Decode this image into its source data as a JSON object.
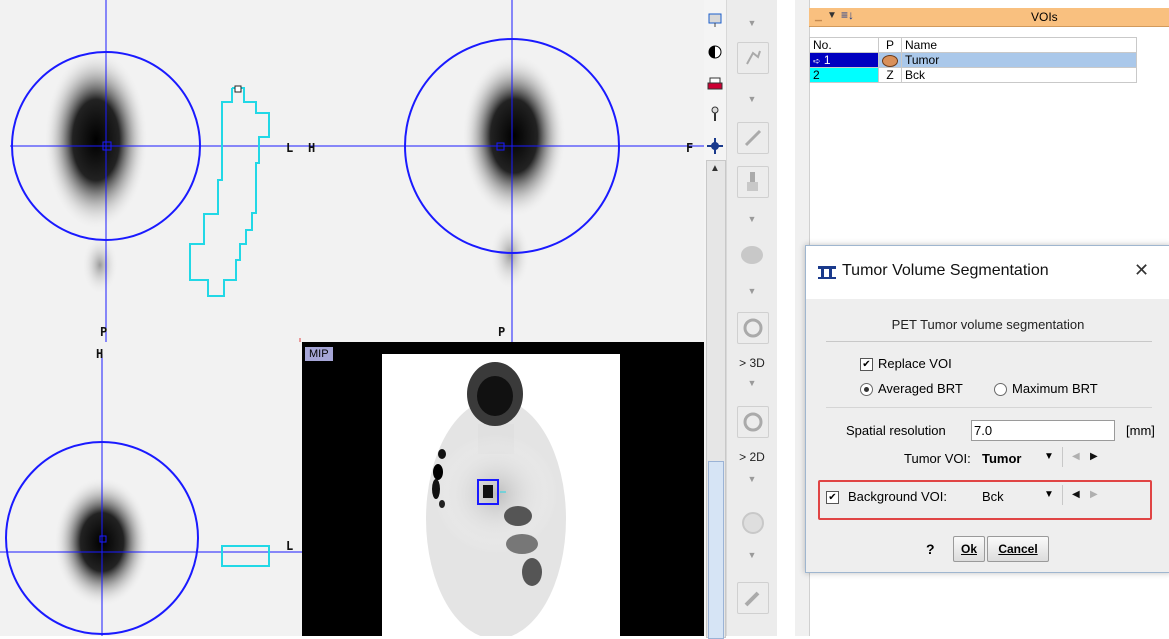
{
  "viewports": {
    "orientation": {
      "transverse_right": "L",
      "coronal_left": "H",
      "coronal_right": "F",
      "transverse_bottom": "P",
      "coronal_bottom": "P",
      "sagittal_top": "H",
      "sagittal_right": "L"
    },
    "mip_label": "MIP"
  },
  "tool_strip": {
    "to_3d_label": "> 3D",
    "to_2d_label": "> 2D"
  },
  "voi_panel": {
    "header_title": "VOIs",
    "columns": [
      "No.",
      "P",
      "Name"
    ],
    "rows": [
      {
        "no": "1",
        "p": "",
        "name": "Tumor",
        "selected": true,
        "color": "#0000c0"
      },
      {
        "no": "2",
        "p": "Z",
        "name": "Bck",
        "selected": false,
        "color": "#00ffff"
      }
    ]
  },
  "dialog": {
    "title": "Tumor Volume Segmentation",
    "close_glyph": "✕",
    "section_title": "PET Tumor volume segmentation",
    "replace_voi": {
      "label": "Replace VOI",
      "checked": true
    },
    "averaged_brt": {
      "label": "Averaged BRT",
      "selected": true
    },
    "maximum_brt": {
      "label": "Maximum BRT",
      "selected": false
    },
    "spatial_resolution": {
      "label": "Spatial resolution",
      "value": "7.0",
      "unit": "[mm]"
    },
    "tumor_voi": {
      "label": "Tumor VOI:",
      "value": "Tumor"
    },
    "background_voi": {
      "label": "Background VOI:",
      "value": "Bck",
      "checked": true
    },
    "help_label": "?",
    "ok_label": "Ok",
    "cancel_label": "Cancel"
  },
  "colors": {
    "crosshair": "#1a1aff",
    "voi_cyan": "#22d8e6",
    "voi_header": "#f9c07f",
    "highlight_red": "#e04444",
    "selection_blue": "#aac8ea"
  }
}
